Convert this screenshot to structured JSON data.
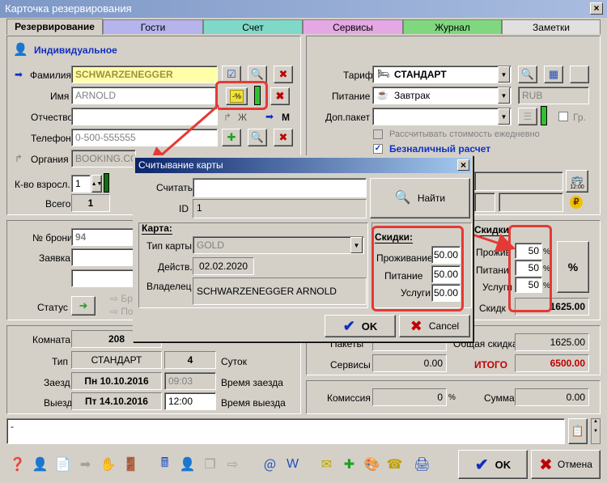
{
  "window": {
    "title": "Карточка резервирования",
    "close": "×"
  },
  "tabs": [
    {
      "label": "Резервирование"
    },
    {
      "label": "Гости"
    },
    {
      "label": "Счет"
    },
    {
      "label": "Сервисы"
    },
    {
      "label": "Журнал"
    },
    {
      "label": "Заметки"
    }
  ],
  "guest": {
    "type_label": "Индивидуальное",
    "surname_label": "Фамилия",
    "surname": "SCHWARZENEGGER",
    "name_label": "Имя",
    "name": "ARNOLD",
    "patronymic_label": "Отчество",
    "gender_f": "Ж",
    "gender_m": "М",
    "phone_label": "Телефон",
    "phone": "0-500-555555",
    "org_label": "Органия",
    "org": "BOOKING.COM",
    "adults_label": "К-во взросл.",
    "adults": "1",
    "total_label": "Всего",
    "total": "1"
  },
  "booking": {
    "number_label": "№ брони",
    "number": "94",
    "request_label": "Заявка",
    "status_label": "Статус",
    "opt1": "Бр",
    "opt2": "По"
  },
  "room": {
    "room_label": "Комната",
    "room": "208",
    "type_label": "Тип",
    "type": "СТАНДАРТ",
    "nights": "4",
    "nights_label": "Суток",
    "checkin_label": "Заезд",
    "checkin_date": "Пн 10.10.2016",
    "checkin_time": "09:03",
    "checkin_time_label": "Время заезда",
    "checkout_label": "Выезд",
    "checkout_date": "Пт 14.10.2016",
    "checkout_time": "12:00",
    "checkout_time_label": "Время выезда"
  },
  "tariff": {
    "tariff_label": "Тариф",
    "tariff": "СТАНДАРТ",
    "meal_label": "Питание",
    "meal": "Завтрак",
    "currency": "RUB",
    "extra_label": "Доп.пакет",
    "gr_label": "Гр.",
    "daily_label": "Рассчитывать стоимость ежедневно",
    "cashless_label": "Безналичный расчет",
    "bus_label": "12:00"
  },
  "discounts": {
    "header": "Скидки",
    "accom_label": "Прожив",
    "accom": "50",
    "meal_label": "Питани",
    "meal": "50",
    "serv_label": "Услуги",
    "serv": "50",
    "pct": "%",
    "pct_btn": "%",
    "sum_label": "Скидк",
    "sum": "1625.00"
  },
  "totals": {
    "packets_label": "Пакеты",
    "overall_discount_label": "Общая скидка",
    "overall_discount": "1625.00",
    "services_label": "Сервисы",
    "services": "0.00",
    "total_label": "ИТОГО",
    "total": "6500.00",
    "commission_label": "Комиссия",
    "commission": "0",
    "commission_pct": "%",
    "sum_label": "Сумма",
    "sum": "0.00"
  },
  "notes": {
    "text": "-"
  },
  "footer": {
    "ok": "OK",
    "cancel": "Отмена"
  },
  "dialog": {
    "title": "Считывание карты",
    "close": "×",
    "read_label": "Считать",
    "read_value": "",
    "id_label": "ID",
    "id": "1",
    "find": "Найти",
    "card_group": "Карта:",
    "card_type_label": "Тип карты",
    "card_type": "GOLD",
    "valid_label": "Действ.",
    "valid": "02.02.2020",
    "owner_label": "Владелец",
    "owner": "SCHWARZENEGGER  ARNOLD",
    "disc_group": "Скидки:",
    "disc_accom_label": "Проживание",
    "disc_accom": "50.00",
    "disc_meal_label": "Питание",
    "disc_meal": "50.00",
    "disc_serv_label": "Услуги",
    "disc_serv": "50.00",
    "ok": "OK",
    "cancel": "Cancel"
  },
  "colors": {
    "highlight": "#e53935",
    "title_blue": "#0a246a",
    "total_red": "#c00000"
  }
}
